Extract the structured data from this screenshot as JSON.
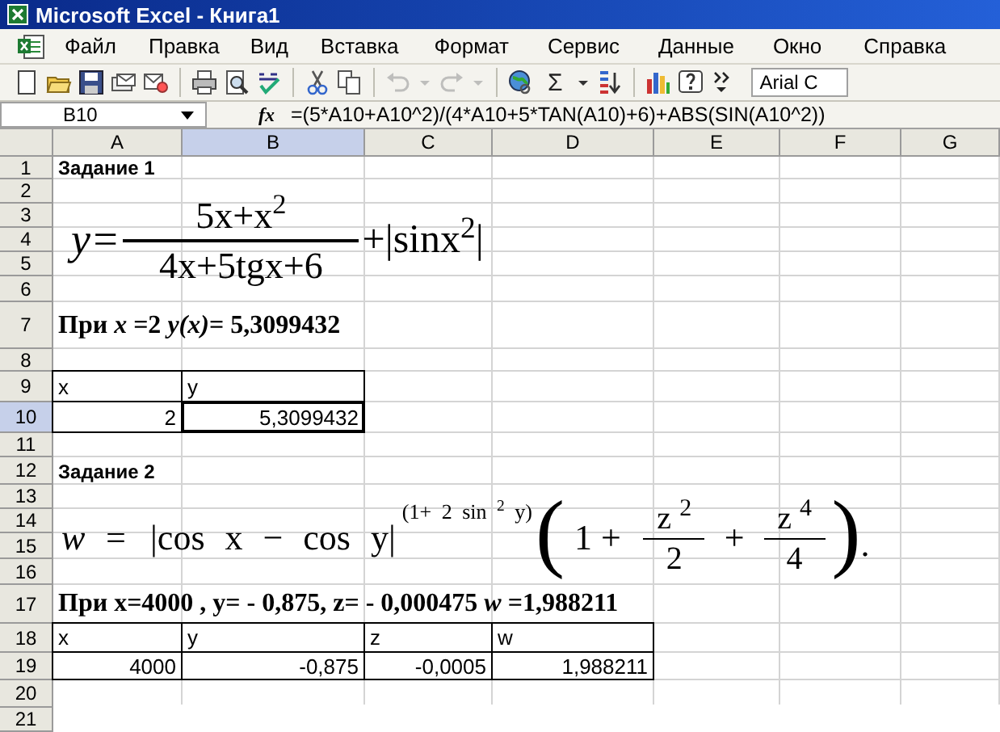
{
  "window": {
    "title": "Microsoft Excel - Книга1"
  },
  "menu": [
    "Файл",
    "Правка",
    "Вид",
    "Вставка",
    "Формат",
    "Сервис",
    "Данные",
    "Окно",
    "Справка"
  ],
  "toolbar": [
    {
      "kind": "new",
      "disabled": false
    },
    {
      "kind": "open",
      "disabled": false
    },
    {
      "kind": "save",
      "disabled": false
    },
    {
      "kind": "permission",
      "disabled": false
    },
    {
      "kind": "mail",
      "disabled": false
    },
    {
      "kind": "sep"
    },
    {
      "kind": "print",
      "disabled": false
    },
    {
      "kind": "preview",
      "disabled": false
    },
    {
      "kind": "spelling",
      "disabled": false
    },
    {
      "kind": "sep"
    },
    {
      "kind": "cut",
      "disabled": false
    },
    {
      "kind": "copy",
      "disabled": false
    },
    {
      "kind": "sep"
    },
    {
      "kind": "undo",
      "disabled": true
    },
    {
      "kind": "caret",
      "disabled": true
    },
    {
      "kind": "redo",
      "disabled": true
    },
    {
      "kind": "caret",
      "disabled": true
    },
    {
      "kind": "sep"
    },
    {
      "kind": "hyperlink",
      "disabled": false
    },
    {
      "kind": "sum",
      "label": "Σ",
      "disabled": false
    },
    {
      "kind": "caret",
      "disabled": false
    },
    {
      "kind": "sort",
      "disabled": false
    },
    {
      "kind": "sep"
    },
    {
      "kind": "chart",
      "disabled": false
    },
    {
      "kind": "help",
      "disabled": false
    },
    {
      "kind": "more",
      "disabled": false
    },
    {
      "kind": "font",
      "value": "Arial C",
      "disabled": false
    }
  ],
  "formula_bar": {
    "name_box": "B10",
    "fx": "fx",
    "formula": "=(5*A10+A10^2)/(4*A10+5*TAN(A10)+6)+ABS(SIN(A10^2))"
  },
  "sheet": {
    "columns": [
      {
        "label": "A",
        "selected": false
      },
      {
        "label": "B",
        "selected": true
      },
      {
        "label": "C",
        "selected": false
      },
      {
        "label": "D",
        "selected": false
      },
      {
        "label": "E",
        "selected": false
      },
      {
        "label": "F",
        "selected": false
      },
      {
        "label": "G",
        "selected": false
      }
    ],
    "rows": [
      {
        "label": "1",
        "selected": false,
        "cells": [
          {
            "kind": "heading",
            "text": "Задание 1",
            "bordered": false,
            "selected": false
          }
        ]
      },
      {
        "label": "2",
        "selected": false
      },
      {
        "label": "3",
        "selected": false
      },
      {
        "label": "4",
        "selected": false
      },
      {
        "label": "5",
        "selected": false
      },
      {
        "label": "6",
        "selected": false
      },
      {
        "label": "7",
        "selected": false,
        "cells": [
          {
            "kind": "note",
            "text": "При *x* =2  *y(x)*= 5,3099432",
            "bordered": false,
            "selected": false
          }
        ]
      },
      {
        "label": "8",
        "selected": false
      },
      {
        "label": "9",
        "selected": false,
        "cells": [
          {
            "kind": "text",
            "text": "x",
            "bordered": true,
            "selected": false
          },
          {
            "kind": "text",
            "text": "y",
            "bordered": true,
            "selected": false
          }
        ]
      },
      {
        "label": "10",
        "selected": true,
        "cells": [
          {
            "kind": "number",
            "text": "2",
            "bordered": true,
            "selected": false
          },
          {
            "kind": "number",
            "text": "5,3099432",
            "bordered": true,
            "selected": true
          }
        ]
      },
      {
        "label": "11",
        "selected": false
      },
      {
        "label": "12",
        "selected": false,
        "cells": [
          {
            "kind": "heading",
            "text": "Задание 2",
            "bordered": false,
            "selected": false
          }
        ]
      },
      {
        "label": "13",
        "selected": false
      },
      {
        "label": "14",
        "selected": false
      },
      {
        "label": "15",
        "selected": false
      },
      {
        "label": "16",
        "selected": false
      },
      {
        "label": "17",
        "selected": false,
        "cells": [
          {
            "kind": "note",
            "text": "При x=4000 , y= - 0,875, z= - 0,000475 *w* =1,988211",
            "bordered": false,
            "selected": false
          }
        ]
      },
      {
        "label": "18",
        "selected": false,
        "cells": [
          {
            "kind": "text",
            "text": "x",
            "bordered": true,
            "selected": false
          },
          {
            "kind": "text",
            "text": "y",
            "bordered": true,
            "selected": false
          },
          {
            "kind": "text",
            "text": "z",
            "bordered": true,
            "selected": false
          },
          {
            "kind": "text",
            "text": "w",
            "bordered": true,
            "selected": false
          }
        ]
      },
      {
        "label": "19",
        "selected": false,
        "cells": [
          {
            "kind": "number",
            "text": "4000",
            "bordered": true,
            "selected": false
          },
          {
            "kind": "number",
            "text": "-0,875",
            "bordered": true,
            "selected": false
          },
          {
            "kind": "number",
            "text": "-0,0005",
            "bordered": true,
            "selected": false
          },
          {
            "kind": "number",
            "text": "1,988211",
            "bordered": true,
            "selected": false
          }
        ]
      },
      {
        "label": "20",
        "selected": false
      },
      {
        "label": "21",
        "selected": false
      }
    ]
  },
  "equations": [
    {
      "kind": "fraction",
      "lhs": "y=",
      "numerator": "5x+x$^{2}$",
      "denominator": "4x+5tgx+6",
      "tail": "+|sinx$^{2}$|"
    },
    {
      "kind": "power",
      "lhs": "w =",
      "abs": "|cos  x − cos  y|",
      "exponent": "(1+ 2 sin $^{2}$ y)",
      "open": "(",
      "one": "1 +",
      "fractions": [
        {
          "numerator": "z $^{2}$",
          "denominator": "2"
        },
        {
          "numerator": "z $^{4}$",
          "denominator": "4"
        }
      ],
      "plus": "+",
      "close": ")",
      "end": "."
    }
  ]
}
